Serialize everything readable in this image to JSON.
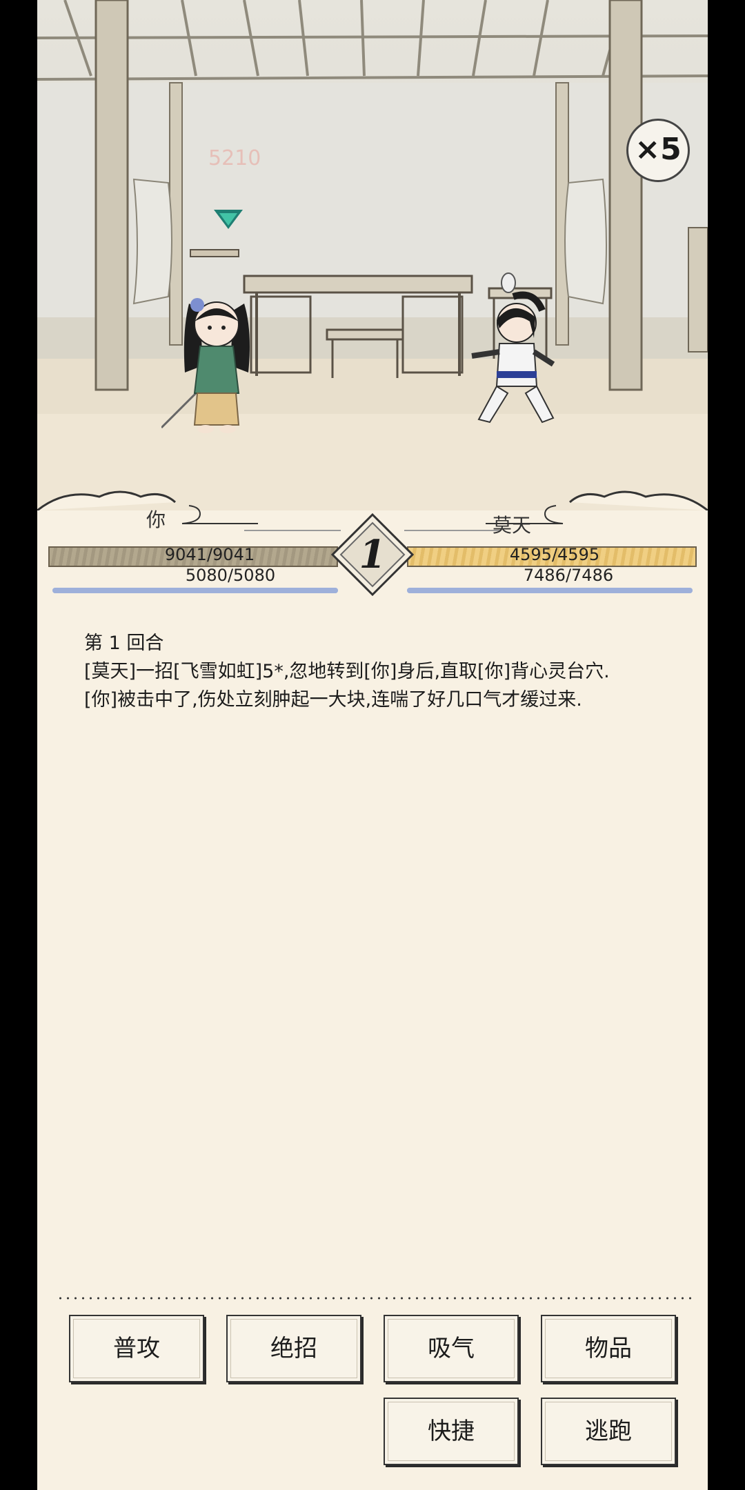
{
  "scene": {
    "speed_multiplier": "×5",
    "ghost_damage": "5210"
  },
  "player": {
    "name": "你",
    "hp": "9041/9041",
    "hp_fraction": 1.0,
    "mp": "5080/5080",
    "mp_fraction": 1.0
  },
  "enemy": {
    "name": "莫天",
    "hp": "4595/4595",
    "hp_fraction": 1.0,
    "mp": "7486/7486",
    "mp_fraction": 1.0
  },
  "round": "1",
  "log": [
    "第 1 回合",
    "[莫天]一招[飞雪如虹]5*,忽地转到[你]身后,直取[你]背心灵台穴.",
    "[你]被击中了,伤处立刻肿起一大块,连喘了好几口气才缓过来."
  ],
  "actions": {
    "attack": "普攻",
    "special": "绝招",
    "breathe": "吸气",
    "items": "物品",
    "quick": "快捷",
    "flee": "逃跑"
  },
  "colors": {
    "parchment": "#f8f1e3",
    "player_hp": "#a69b83",
    "enemy_hp": "#e8c676",
    "mp": "#b9c6e4",
    "target_marker": "#2aa38c"
  }
}
